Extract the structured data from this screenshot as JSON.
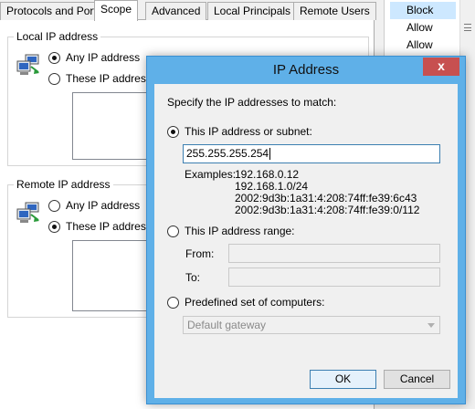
{
  "tabs": [
    {
      "label": "Protocols and Ports"
    },
    {
      "label": "Scope"
    },
    {
      "label": "Advanced"
    },
    {
      "label": "Local Principals"
    },
    {
      "label": "Remote Users"
    }
  ],
  "local_ip": {
    "title": "Local IP address",
    "any_label": "Any IP address",
    "these_label": "These IP address"
  },
  "remote_ip": {
    "title": "Remote IP address",
    "any_label": "Any IP address",
    "these_label": "These IP address"
  },
  "right_list": [
    "Block",
    "Allow",
    "Allow"
  ],
  "dialog": {
    "title": "IP Address",
    "close_glyph": "x",
    "instruction": "Specify the IP addresses to match:",
    "subnet_label": "This IP address or subnet:",
    "subnet_value": "255.255.255.254",
    "examples_label": "Examples:",
    "examples": [
      "192.168.0.12",
      "192.168.1.0/24",
      "2002:9d3b:1a31:4:208:74ff:fe39:6c43",
      "2002:9d3b:1a31:4:208:74ff:fe39:0/112"
    ],
    "range_label": "This IP address range:",
    "from_label": "From:",
    "to_label": "To:",
    "predefined_label": "Predefined set of computers:",
    "predefined_value": "Default gateway",
    "ok_label": "OK",
    "cancel_label": "Cancel"
  }
}
